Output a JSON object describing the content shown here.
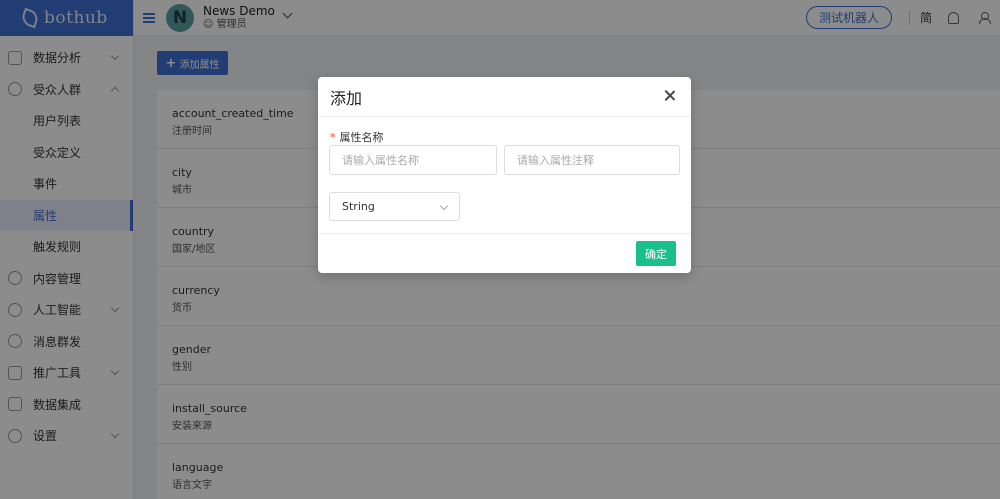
{
  "app": {
    "logo_text": "bothub"
  },
  "header": {
    "avatar_letter": "N",
    "project_name": "News Demo",
    "project_role": "管理员",
    "test_robot_label": "测试机器人",
    "language_label": "简"
  },
  "sidebar": {
    "items": [
      {
        "label": "数据分析",
        "icon": "chart-icon",
        "expandable": true
      },
      {
        "label": "受众人群",
        "icon": "users-icon",
        "expandable": true,
        "expanded": true
      },
      {
        "label": "用户列表"
      },
      {
        "label": "受众定义"
      },
      {
        "label": "事件"
      },
      {
        "label": "属性",
        "active": true
      },
      {
        "label": "触发规则"
      },
      {
        "label": "内容管理",
        "icon": "content-icon"
      },
      {
        "label": "人工智能",
        "icon": "ai-icon",
        "expandable": true
      },
      {
        "label": "消息群发",
        "icon": "broadcast-icon"
      },
      {
        "label": "推广工具",
        "icon": "promotion-icon",
        "expandable": true
      },
      {
        "label": "数据集成",
        "icon": "integration-icon"
      },
      {
        "label": "设置",
        "icon": "settings-icon",
        "expandable": true
      }
    ]
  },
  "main": {
    "add_button_label": "添加属性",
    "attributes": [
      {
        "name": "account_created_time",
        "desc": "注册时间"
      },
      {
        "name": "city",
        "desc": "城市"
      },
      {
        "name": "country",
        "desc": "国家/地区"
      },
      {
        "name": "currency",
        "desc": "货币"
      },
      {
        "name": "gender",
        "desc": "性别"
      },
      {
        "name": "install_source",
        "desc": "安装来源"
      },
      {
        "name": "language",
        "desc": "语言文字"
      }
    ]
  },
  "modal": {
    "title": "添加",
    "field_label": "属性名称",
    "name_placeholder": "请输入属性名称",
    "note_placeholder": "请输入属性注释",
    "type_value": "String",
    "confirm_label": "确定"
  },
  "colors": {
    "primary": "#3f6fd1",
    "confirm": "#19c08a",
    "required": "#e74c3c"
  }
}
